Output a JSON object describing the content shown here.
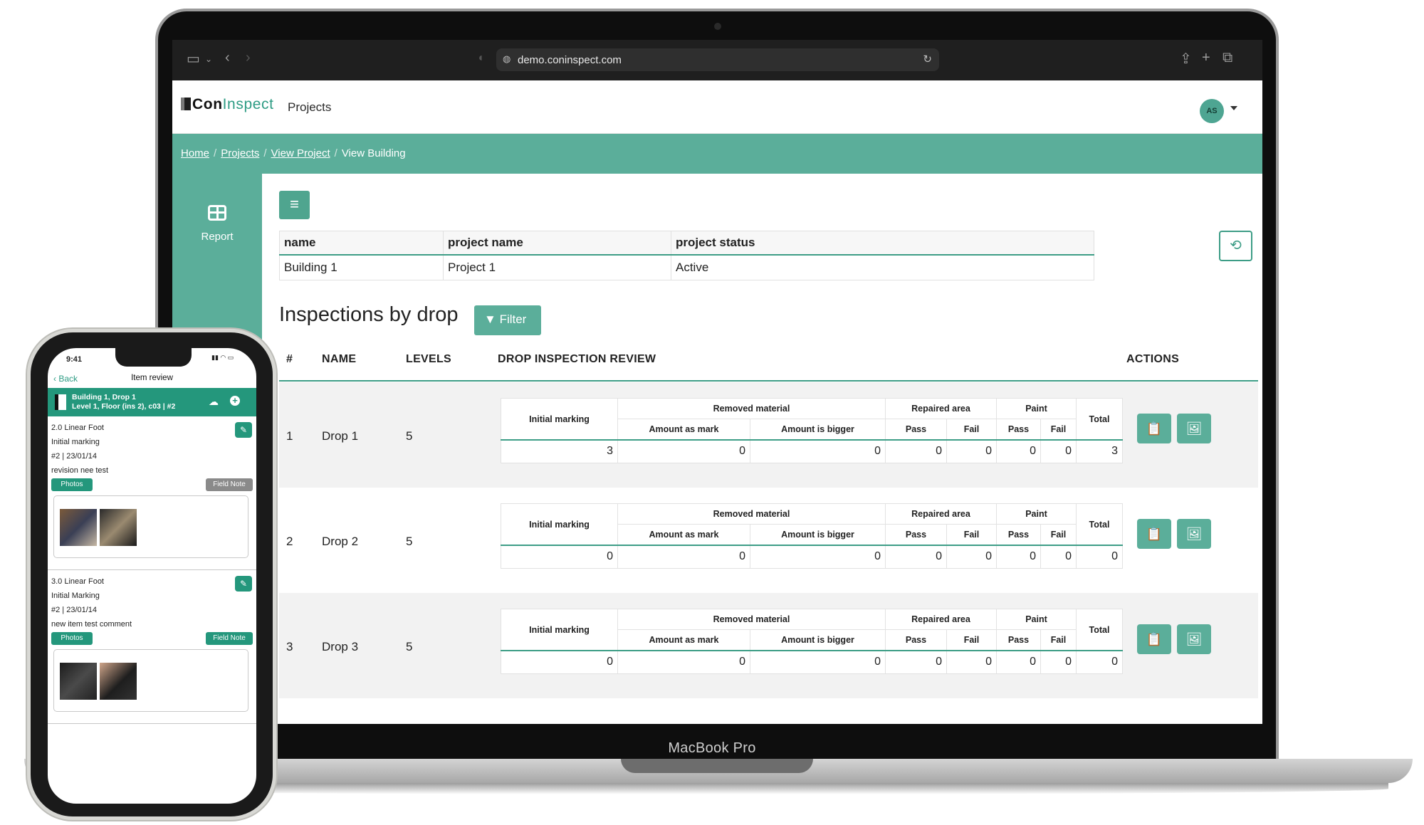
{
  "browser": {
    "url": "demo.coninspect.com"
  },
  "app": {
    "logo_con": "Con",
    "logo_inspect": "Inspect",
    "nav_projects": "Projects",
    "avatar_initials": "AS"
  },
  "breadcrumb": {
    "home": "Home",
    "projects": "Projects",
    "view_project": "View Project",
    "current": "View Building"
  },
  "sidebar": {
    "report_label": "Report"
  },
  "info_table": {
    "headers": [
      "name",
      "project name",
      "project status"
    ],
    "values": [
      "Building 1",
      "Project 1",
      "Active"
    ]
  },
  "inspections": {
    "title": "Inspections by drop",
    "filter_label": "Filter",
    "columns": {
      "num": "#",
      "name": "NAME",
      "levels": "LEVELS",
      "review": "DROP INSPECTION REVIEW",
      "actions": "ACTIONS"
    },
    "review_headers": {
      "initial_marking": "Initial marking",
      "removed_material": "Removed material",
      "repaired_area": "Repaired area",
      "paint": "Paint",
      "total": "Total",
      "amount_as_mark": "Amount as mark",
      "amount_is_bigger": "Amount is bigger",
      "pass": "Pass",
      "fail": "Fail"
    },
    "rows": [
      {
        "num": "1",
        "name": "Drop 1",
        "levels": "5",
        "vals": [
          "3",
          "0",
          "0",
          "0",
          "0",
          "0",
          "0",
          "3"
        ]
      },
      {
        "num": "2",
        "name": "Drop 2",
        "levels": "5",
        "vals": [
          "0",
          "0",
          "0",
          "0",
          "0",
          "0",
          "0",
          "0"
        ]
      },
      {
        "num": "3",
        "name": "Drop 3",
        "levels": "5",
        "vals": [
          "0",
          "0",
          "0",
          "0",
          "0",
          "0",
          "0",
          "0"
        ]
      }
    ]
  },
  "device_label": "MacBook Pro",
  "phone": {
    "time": "9:41",
    "back": "Back",
    "title": "Item review",
    "header_line1": "Building 1, Drop 1",
    "header_line2": "Level 1, Floor (ins 2), c03  |  #2",
    "items": [
      {
        "title": "2.0 Linear Foot",
        "stage": "Initial marking",
        "meta": "#2 | 23/01/14",
        "comment": "revision nee test",
        "photos": "Photos",
        "field_note": "Field Note"
      },
      {
        "title": "3.0 Linear Foot",
        "stage": "Initial Marking",
        "meta": "#2 | 23/01/14",
        "comment": "new item test comment",
        "photos": "Photos",
        "field_note": "Field Note"
      }
    ]
  },
  "colors": {
    "accent": "#5bae9a",
    "accent_dark": "#3d9d86",
    "phone_accent": "#24977c"
  },
  "icons": [
    "sidebar-icon",
    "back-icon",
    "forward-icon",
    "shield-icon",
    "globe-icon",
    "reload-icon",
    "share-icon",
    "plus-icon",
    "tabs-icon",
    "hamburger-icon",
    "history-icon",
    "filter-icon",
    "clipboard-icon",
    "image-icon",
    "report-grid-icon",
    "cloud-icon",
    "edit-icon"
  ]
}
